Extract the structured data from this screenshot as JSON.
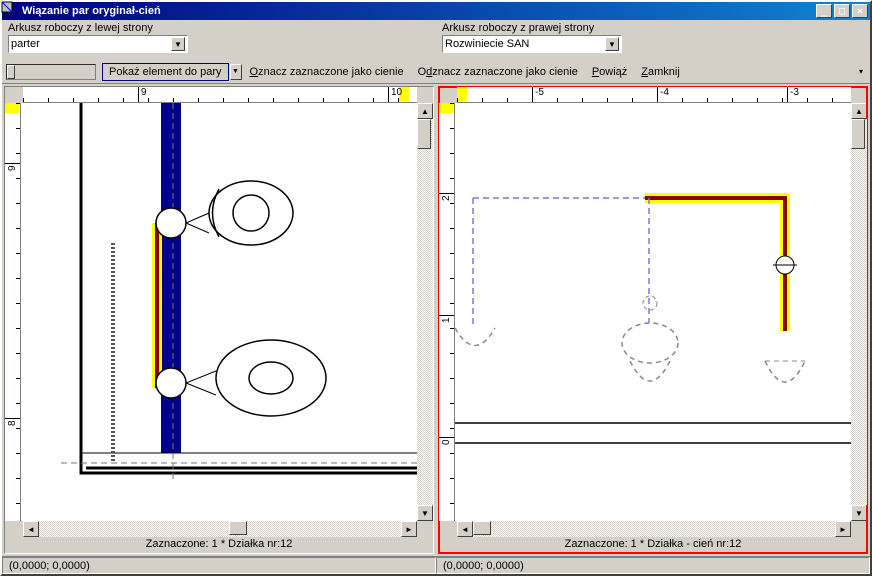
{
  "title": "Wiązanie par oryginał-cień",
  "header": {
    "left_label": "Arkusz roboczy z lewej strony",
    "left_value": "parter",
    "right_label": "Arkusz roboczy z prawej strony",
    "right_value": "Rozwiniecie SAN"
  },
  "toolbar": {
    "show_pair_btn": "Pokaż element do pary",
    "mark_shadows": "Oznacz zaznaczone jako cienie",
    "unmark_shadows": "Odznacz zaznaczone jako cienie",
    "bind": "Powiąż",
    "close": "Zamknij"
  },
  "left_pane": {
    "ruler_h_ticks": [
      {
        "pos": 115,
        "label": "9"
      },
      {
        "pos": 365,
        "label": "10"
      }
    ],
    "ruler_v_ticks": [
      {
        "pos": 60,
        "label": "9"
      },
      {
        "pos": 315,
        "label": "8"
      }
    ],
    "status": "Zaznaczone: 1 * Działka nr:12"
  },
  "right_pane": {
    "ruler_h_ticks": [
      {
        "pos": 75,
        "label": "-5"
      },
      {
        "pos": 200,
        "label": "-4"
      },
      {
        "pos": 330,
        "label": "-3"
      }
    ],
    "ruler_v_ticks": [
      {
        "pos": 90,
        "label": "2"
      },
      {
        "pos": 212,
        "label": "1"
      },
      {
        "pos": 334,
        "label": "0"
      }
    ],
    "status": "Zaznaczone: 1 * Działka - cień nr:12"
  },
  "statusbar": {
    "left": "(0,0000; 0,0000)",
    "right": "(0,0000; 0,0000)"
  },
  "icons": {
    "min": "_",
    "max": "□",
    "close": "×",
    "down": "▼",
    "left": "◄",
    "right": "►",
    "up": "▲"
  }
}
